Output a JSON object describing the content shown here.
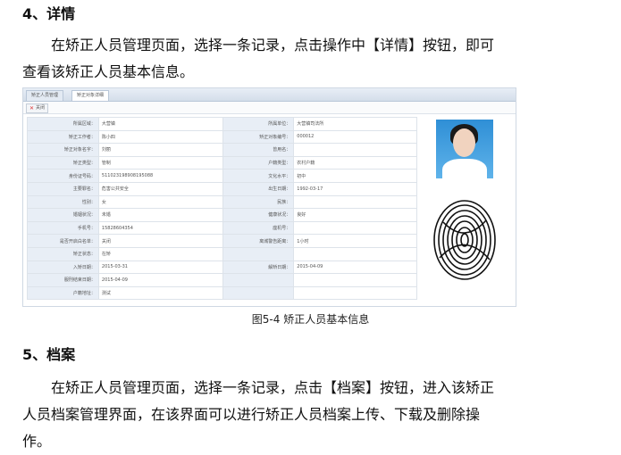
{
  "section4": {
    "heading": "4、详情",
    "para_line1": "在矫正人员管理页面，选择一条记录，点击操作中【详情】按钮，即可",
    "para_line2": "查看该矫正人员基本信息。"
  },
  "screenshot": {
    "tabs": [
      "矫正人员管理",
      "矫正对象详细"
    ],
    "close_button": "关闭",
    "rows": [
      [
        "所属区域：",
        "大营镇",
        "所属单位：",
        "大营镇司法所"
      ],
      [
        "矫正工作者：",
        "陈小四",
        "矫正对象编号：",
        "000012"
      ],
      [
        "矫正对象名字：",
        "刘丽",
        "曾用名：",
        ""
      ],
      [
        "矫正类型：",
        "管制",
        "户籍类型：",
        "农村户籍"
      ],
      [
        "身份证号码：",
        "511023198908195088",
        "文化水平：",
        "初中"
      ],
      [
        "主要罪名：",
        "危害公共安全",
        "出生日期：",
        "1992-03-17"
      ],
      [
        "性别：",
        "女",
        "民族：",
        ""
      ],
      [
        "婚姻状况：",
        "未婚",
        "健康状况：",
        "良好"
      ],
      [
        "手机号：",
        "15828604354",
        "座机号：",
        ""
      ],
      [
        "是否开启白名单：",
        "关闭",
        "离城警告距离：",
        "1小时"
      ],
      [
        "矫正状态：",
        "在矫",
        "",
        ""
      ],
      [
        "入矫日期：",
        "2015-03-31",
        "解矫日期：",
        "2015-04-09"
      ],
      [
        "服刑结束日期：",
        "2015-04-09",
        "",
        ""
      ],
      [
        "户籍地址：",
        "测试",
        "",
        ""
      ]
    ]
  },
  "caption": "图5-4 矫正人员基本信息",
  "section5": {
    "heading": "5、档案",
    "para_line1": "在矫正人员管理页面，选择一条记录，点击【档案】按钮，进入该矫正",
    "para_line2": "人员档案管理界面，在该界面可以进行矫正人员档案上传、下载及删除操",
    "para_line3": "作。"
  }
}
